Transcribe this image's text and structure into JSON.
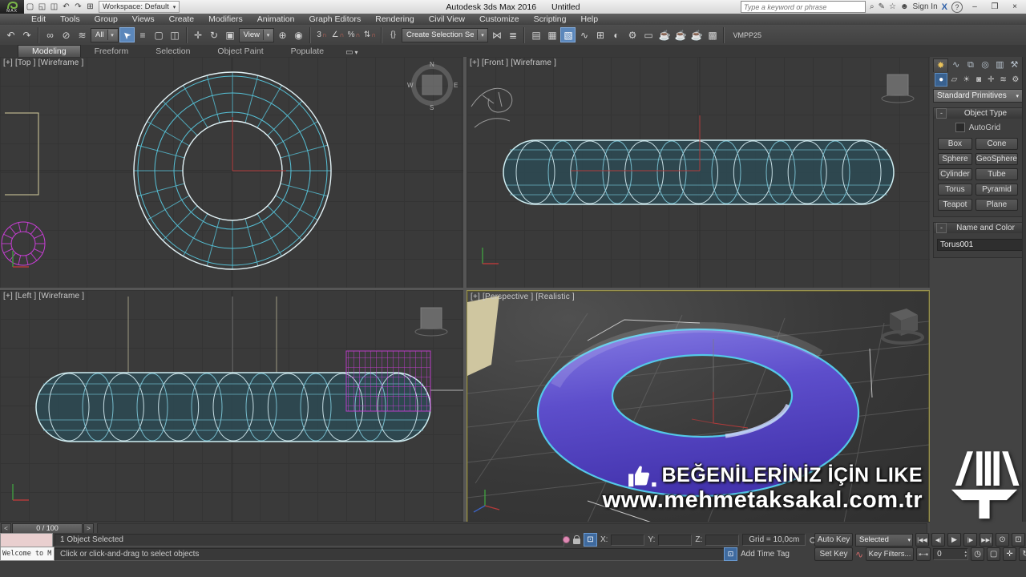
{
  "colors": {
    "accent_blue": "#5b87bb",
    "wire_cyan": "#56c2d8",
    "selected_white": "#e4f4f8",
    "torus_purple": "#5b4bc6",
    "magenta_wire": "#c93ed6",
    "viewport_bg": "#3a3a3a",
    "panel_bg": "#434343",
    "active_viewport_border": "#96904e",
    "red_axis": "#b23b3b",
    "name_swatch": "#7a1fd0"
  },
  "titlebar": {
    "logo_text": "MAX",
    "workspace": "Workspace: Default",
    "app_title": "Autodesk 3ds Max 2016",
    "doc_title": "Untitled",
    "search_placeholder": "Type a keyword or phrase",
    "sign_in": "Sign In",
    "quick_icons": [
      "▢",
      "◱",
      "◫",
      "↶",
      "↷",
      "⊞"
    ],
    "search_icons": {
      "binoculars": "⌕",
      "communicate": "✎",
      "favorites": "☆",
      "person": "☻",
      "exchange": "X",
      "help": "?"
    },
    "window": {
      "minimize": "–",
      "restore": "❒",
      "close": "×"
    }
  },
  "menu": {
    "items": [
      "Edit",
      "Tools",
      "Group",
      "Views",
      "Create",
      "Modifiers",
      "Animation",
      "Graph Editors",
      "Rendering",
      "Civil View",
      "Customize",
      "Scripting",
      "Help"
    ]
  },
  "toolbar": {
    "filter_dropdown": "All",
    "coord_dropdown": "View",
    "selection_set_dropdown": "Create Selection Se",
    "vmpp_label": "VMPP25",
    "icons": [
      "↶",
      "↷",
      "∞",
      "⊘",
      "≋",
      "➤",
      "≡",
      "▢",
      "◫",
      "✛",
      "↻",
      "▣",
      "⊕",
      "◉",
      "3",
      "∠",
      "%",
      "⇅",
      "{}",
      "⋈",
      "≣",
      "▤",
      "▦",
      "▧",
      "∿",
      "⊞",
      "◐",
      "⚙",
      "▭",
      "☕",
      "☕",
      "☕",
      "▩"
    ]
  },
  "ribbon": {
    "tabs": [
      "Modeling",
      "Freeform",
      "Selection",
      "Object Paint",
      "Populate"
    ],
    "overflow_icon": "▭",
    "overflow_caret": "▾"
  },
  "viewports": {
    "top_label": "[+] [Top ] [Wireframe ]",
    "front_label": "[+] [Front ] [Wireframe ]",
    "left_label": "[+] [Left ] [Wireframe ]",
    "persp_label": "[+] [Perspective ] [Realistic ]",
    "compass": {
      "n": "N",
      "e": "E",
      "s": "S",
      "w": "W"
    }
  },
  "panel": {
    "tab_icons": [
      "✸",
      "∿",
      "⧉",
      "◎",
      "▥",
      "⚒"
    ],
    "sub_icons": [
      "●",
      "▱",
      "☀",
      "◙",
      "✛",
      "≋",
      "⚙"
    ],
    "category_dropdown": "Standard Primitives",
    "dropdown_caret": "▾",
    "object_type": {
      "title": "Object Type",
      "collapse": "-",
      "autogrid": "AutoGrid",
      "buttons": [
        "Box",
        "Cone",
        "Sphere",
        "GeoSphere",
        "Cylinder",
        "Tube",
        "Torus",
        "Pyramid",
        "Teapot",
        "Plane"
      ]
    },
    "name_color": {
      "title": "Name and Color",
      "collapse": "-",
      "name": "Torus001"
    }
  },
  "watermark": {
    "line1": "BEĞENİLERİNİZ İÇİN LIKE",
    "line2": "www.mehmetaksakal.com.tr"
  },
  "timeline": {
    "prev": "<",
    "frame_display": "0 / 100",
    "next": ">"
  },
  "statusbar": {
    "listener_text": "Welcome to M",
    "selection_status": "1 Object Selected",
    "prompt": "Click or click-and-drag to select objects",
    "x_label": "X:",
    "y_label": "Y:",
    "z_label": "Z:",
    "grid_label": "Grid = 10,0cm",
    "add_time_tag": "Add Time Tag",
    "time_tag_icon": "⊡",
    "auto_key": "Auto Key",
    "set_key": "Set Key",
    "key_mode_dropdown": "Selected",
    "key_filters": "Key Filters...",
    "key_mode_toggle": "⇤⇥",
    "curve_icon": "∿",
    "frame_field": "0",
    "spinner_up": "▴",
    "spinner_down": "▾",
    "playback": [
      "|◀◀",
      "◀|",
      "▶",
      "|▶",
      "▶▶|"
    ],
    "nav_icons_row1": [
      "⊙",
      "⊡",
      "▣",
      "▩"
    ],
    "nav_icons_row2": [
      "▢",
      "✛",
      "↻",
      "▣"
    ],
    "time_config_icon": "◷"
  }
}
